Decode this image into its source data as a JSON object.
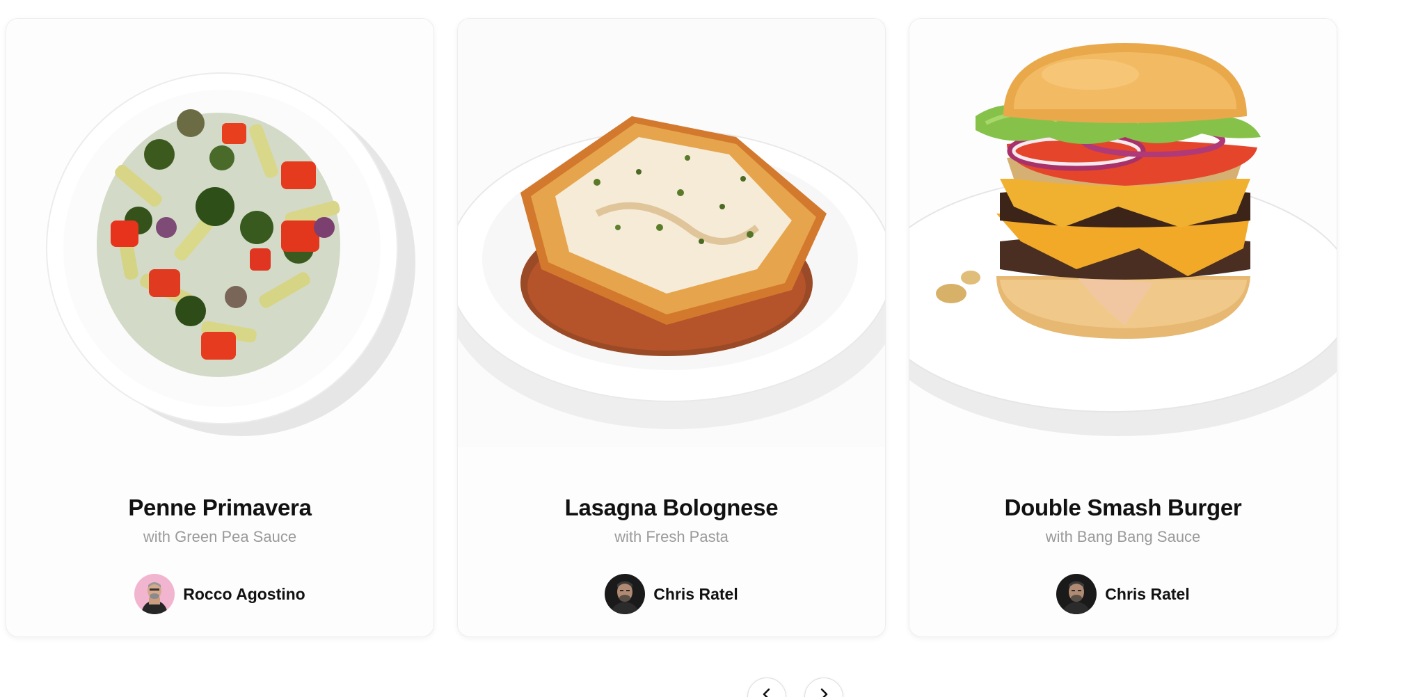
{
  "cards": [
    {
      "title": "Penne Primavera",
      "subtitle": "with Green Pea Sauce",
      "chef": "Rocco Agostino"
    },
    {
      "title": "Lasagna Bolognese",
      "subtitle": "with Fresh Pasta",
      "chef": "Chris Ratel"
    },
    {
      "title": "Double Smash Burger",
      "subtitle": "with Bang Bang Sauce",
      "chef": "Chris Ratel"
    }
  ],
  "navigation": {
    "prev_icon": "chevron-left-icon",
    "next_icon": "chevron-right-icon"
  },
  "colors": {
    "title": "#111111",
    "subtitle": "#9a9a9a",
    "card_border": "#eeeeee"
  }
}
